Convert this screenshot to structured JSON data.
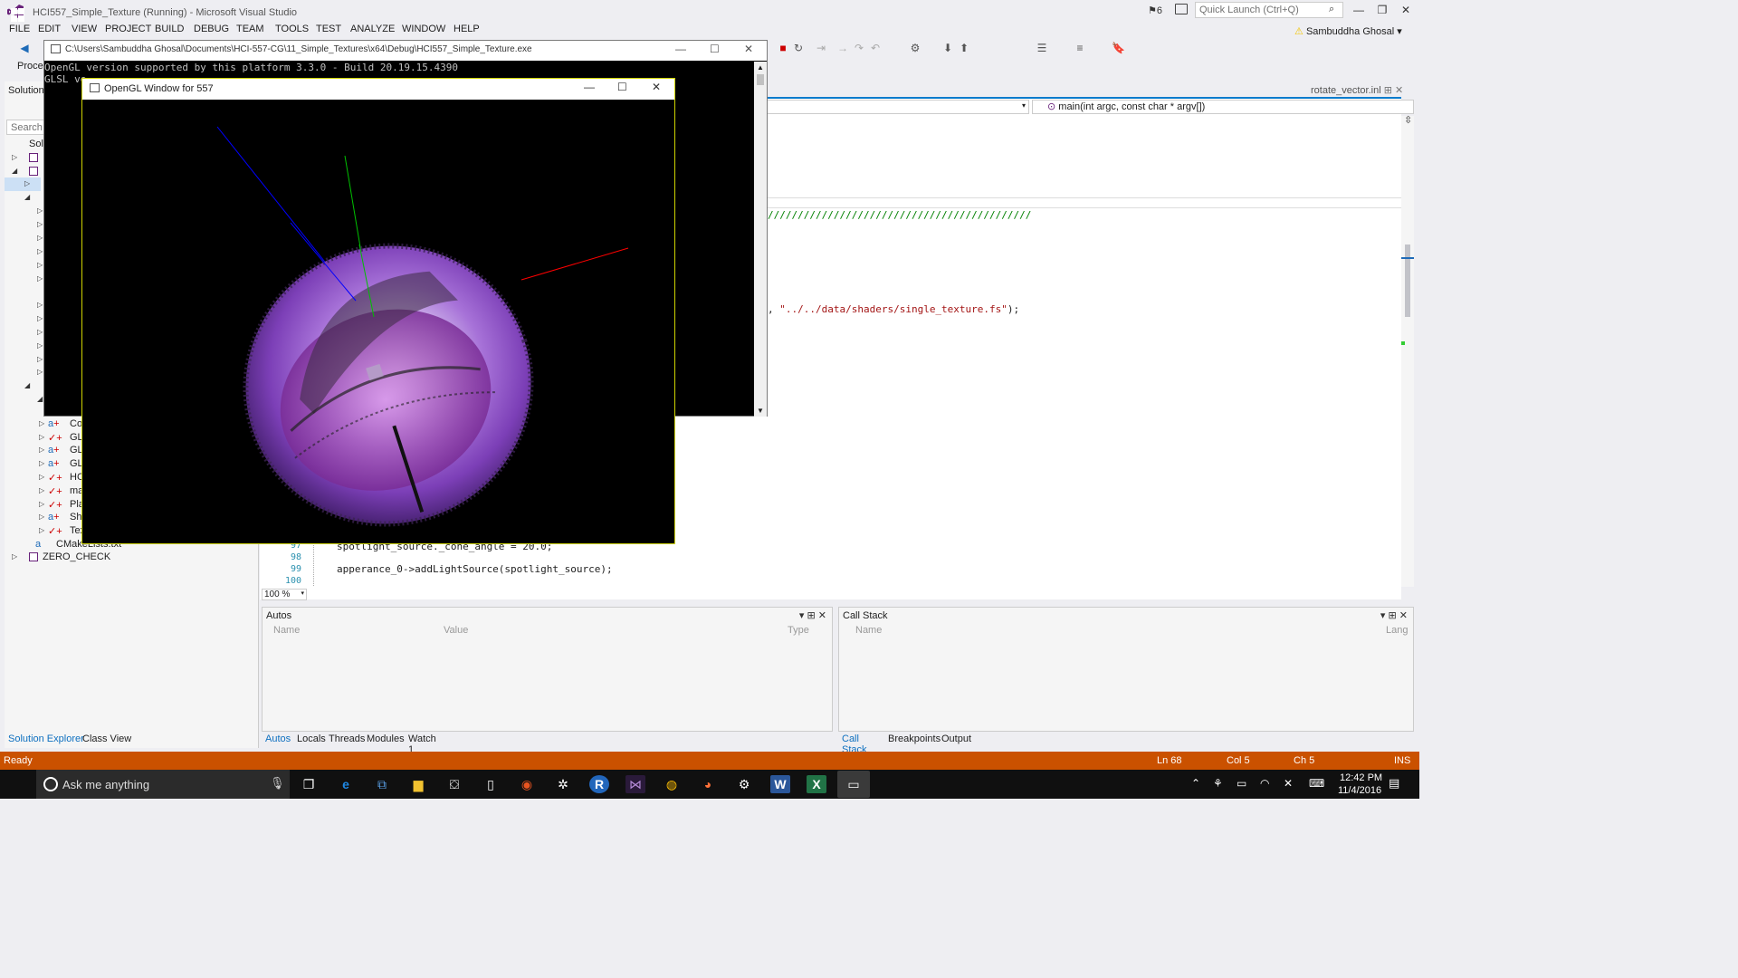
{
  "vs": {
    "title": "HCI557_Simple_Texture (Running) - Microsoft Visual Studio",
    "notifications": "6",
    "quick_launch_placeholder": "Quick Launch (Ctrl+Q)",
    "user": "Sambuddha Ghosal",
    "menu": [
      "FILE",
      "EDIT",
      "VIEW",
      "PROJECT",
      "BUILD",
      "DEBUG",
      "TEAM",
      "TOOLS",
      "TEST",
      "ANALYZE",
      "WINDOW",
      "HELP"
    ],
    "process_label": "Proces"
  },
  "solution_explorer": {
    "title": "Solution",
    "search_placeholder": "Search So",
    "items": [
      {
        "label": "Solu"
      },
      {
        "label": "Cod"
      },
      {
        "label": "GLA"
      },
      {
        "label": "GLO"
      },
      {
        "label": "GLS"
      },
      {
        "label": "HC"
      },
      {
        "label": "ma"
      },
      {
        "label": "Pla"
      },
      {
        "label": "Sha"
      },
      {
        "label": "Tex"
      },
      {
        "label": "CMakeLists.txt"
      },
      {
        "label": "ZERO_CHECK"
      }
    ],
    "tabs": [
      "Solution Explorer",
      "Class View"
    ]
  },
  "editor": {
    "tab": "rotate_vector.inl",
    "nav_function": "main(int argc, const char * argv[])",
    "comment_line": "////////////////////////////////////////////",
    "string_line_prefix": ", ",
    "string_line_string": "\"../../data/shaders/single_texture.fs\"",
    "string_line_suffix": ");",
    "lines": [
      {
        "num": "97",
        "code": "spotlight_source._cone_angle = 20.0;"
      },
      {
        "num": "98",
        "code": ""
      },
      {
        "num": "99",
        "code": "apperance_0->addLightSource(spotlight_source);"
      },
      {
        "num": "100",
        "code": ""
      }
    ],
    "zoom": "100 %"
  },
  "autos": {
    "title": "Autos",
    "columns": [
      "Name",
      "Value",
      "Type"
    ],
    "tabs": [
      "Autos",
      "Locals",
      "Threads",
      "Modules",
      "Watch 1"
    ]
  },
  "call_stack": {
    "title": "Call Stack",
    "columns": [
      "Name",
      "Lang"
    ],
    "tabs": [
      "Call Stack",
      "Breakpoints",
      "Output"
    ]
  },
  "status": {
    "ready": "Ready",
    "line": "Ln 68",
    "col": "Col 5",
    "ch": "Ch 5",
    "mode": "INS"
  },
  "console": {
    "title": "C:\\Users\\Sambuddha Ghosal\\Documents\\HCI-557-CG\\11_Simple_Textures\\x64\\Debug\\HCI557_Simple_Texture.exe",
    "line1": "OpenGL version supported by this platform 3.3.0 - Build 20.19.15.4390",
    "line2": "GLSL ve"
  },
  "gl_window": {
    "title": "OpenGL Window for 557"
  },
  "taskbar": {
    "search_placeholder": "Ask me anything",
    "time": "12:42 PM",
    "date": "11/4/2016"
  },
  "colors": {
    "vs_accent": "#007acc",
    "status_bar": "#ca5100",
    "taskbar": "#101010",
    "axis_x": "#ff0000",
    "axis_y": "#00c000",
    "axis_z": "#0000ff",
    "comment": "#008000",
    "string": "#a31515"
  }
}
